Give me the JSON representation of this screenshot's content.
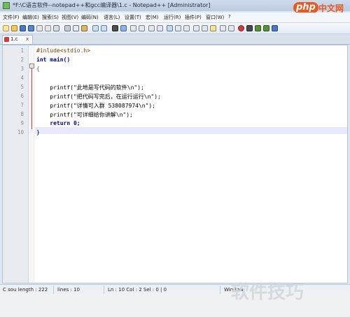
{
  "window": {
    "title": "*F:\\C语言软件--notepad++和gcc编译器\\1.c - Notepad++ [Administrator]"
  },
  "logo": {
    "mark": "php",
    "text": "中文网"
  },
  "menu": [
    "文件(F)",
    "编辑(E)",
    "搜索(S)",
    "视图(V)",
    "编码(N)",
    "语言(L)",
    "设置(T)",
    "宏(M)",
    "运行(R)",
    "插件(P)",
    "窗口(W)",
    "?"
  ],
  "tab": {
    "name": "1.c",
    "close": "x"
  },
  "editor": {
    "line_numbers": [
      "1",
      "2",
      "3",
      "4",
      "5",
      "6",
      "7",
      "8",
      "9",
      "10"
    ],
    "lines": [
      "#inlude<stdio.h>",
      "int main()",
      "{",
      "",
      "    printf(\"此地是写代码的软件\\n\");",
      "    printf(\"把代码写完后，在运行运行\\n\");",
      "    printf(\"详情可入群 538087974\\n\");",
      "    printf(\"可详细给你讲解\\n\");",
      "    return 0;",
      "}"
    ]
  },
  "status": {
    "file_info": "C sou length : 222",
    "lines": "lines : 10",
    "position": "Ln : 10   Col : 2   Sel : 0 | 0",
    "eol": "Window"
  },
  "watermark": "软件技巧",
  "colors": {
    "keyword": "#00008b",
    "string": "#7c7c7c",
    "number": "#ff8000",
    "preprocessor": "#804000",
    "current_line": "#e8e8ff",
    "fold_marker": "#d23b3b"
  }
}
